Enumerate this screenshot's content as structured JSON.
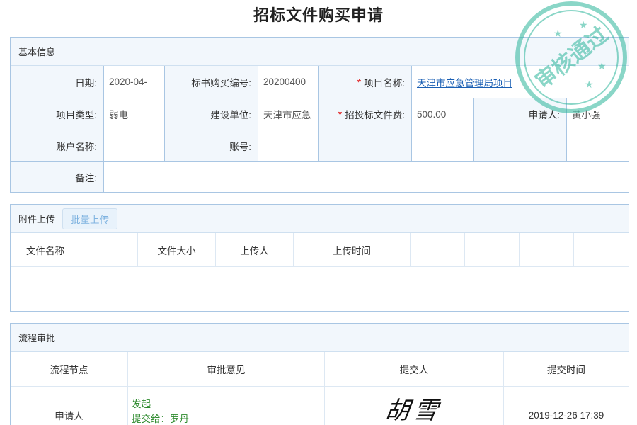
{
  "page": {
    "title": "招标文件购买申请"
  },
  "basic_info": {
    "header": "基本信息",
    "date_label": "日期:",
    "date_value": "2020-04-",
    "bid_no_label": "标书购买编号:",
    "bid_no_value": "20200400",
    "project_name_label": "项目名称:",
    "project_name_value": "天津市应急管理局项目",
    "project_type_label": "项目类型:",
    "project_type_value": "弱电",
    "construction_unit_label": "建设单位:",
    "construction_unit_value": "天津市应急",
    "fee_label": "招投标文件费:",
    "fee_value": "500.00",
    "applicant_label": "申请人:",
    "applicant_value": "黄小强",
    "account_name_label": "账户名称:",
    "account_no_label": "账号:",
    "remark_label": "备注:",
    "required_mark": "*"
  },
  "attachments": {
    "header": "附件上传",
    "batch_upload_label": "批量上传",
    "columns": [
      "文件名称",
      "文件大小",
      "上传人",
      "上传时间"
    ]
  },
  "flow": {
    "header": "流程审批",
    "columns": [
      "流程节点",
      "审批意见",
      "提交人",
      "提交时间"
    ],
    "rows": [
      {
        "node": "申请人",
        "opinion_line1": "发起",
        "opinion_line2": "提交给：罗丹",
        "submitter_signature": "胡雪",
        "time": "2019-12-26 17:39"
      }
    ]
  },
  "stamp": {
    "text": "审核通过",
    "color": "#2bb59a"
  }
}
